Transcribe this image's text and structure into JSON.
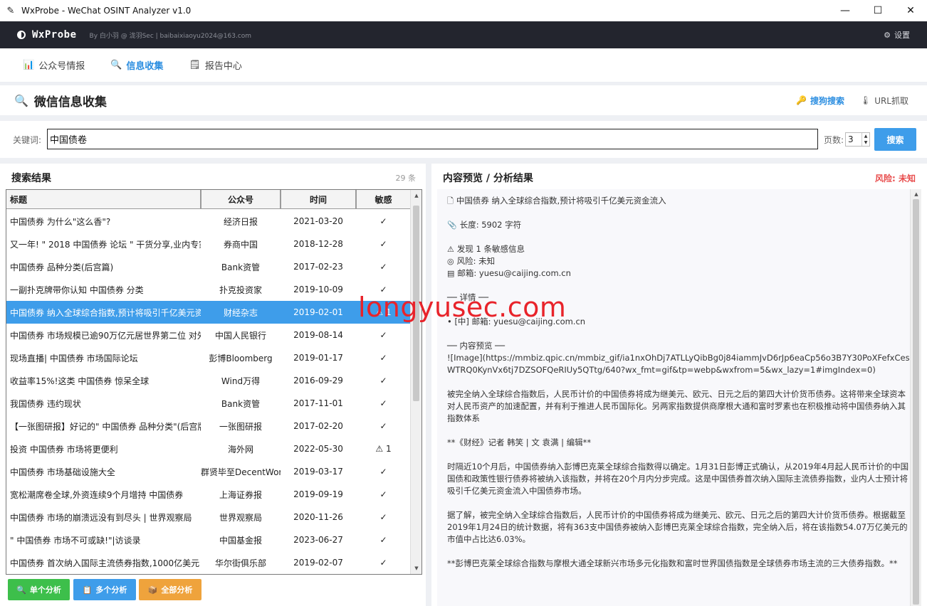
{
  "window": {
    "title": "WxProbe - WeChat OSINT Analyzer v1.0",
    "controls": {
      "minimize": "—",
      "maximize": "☐",
      "close": "✕"
    }
  },
  "appbar": {
    "logo": "WxProbe",
    "meta": "By 白小羽 @ 泷羽Sec  |  baibaixiaoyu2024@163.com",
    "settings_label": "设置"
  },
  "nav": {
    "tabs": [
      {
        "label": "公众号情报",
        "active": false
      },
      {
        "label": "信息收集",
        "active": true
      },
      {
        "label": "报告中心",
        "active": false
      }
    ]
  },
  "section": {
    "title": "微信信息收集",
    "sogou_label": "搜狗搜索",
    "url_label": "URL抓取"
  },
  "search": {
    "keyword_label": "关键词:",
    "keyword_value": "中国债卷",
    "pages_label": "页数:",
    "pages_value": "3",
    "search_button": "搜索"
  },
  "results": {
    "title": "搜索结果",
    "count": "29 条",
    "columns": [
      "标题",
      "公众号",
      "时间",
      "敏感"
    ],
    "rows": [
      {
        "title": "中国债券 为什么\"这么香\"?",
        "account": "经济日报",
        "date": "2021-03-20",
        "sensitive": "✓"
      },
      {
        "title": "又一年! \" 2018 中国债券 论坛 \" 干货分享,业内专家",
        "account": "券商中国",
        "date": "2018-12-28",
        "sensitive": "✓"
      },
      {
        "title": "中国债券 品种分类(后宫篇)",
        "account": "Bank资管",
        "date": "2017-02-23",
        "sensitive": "✓"
      },
      {
        "title": "一副扑克牌带你认知 中国债券 分类",
        "account": "扑克投资家",
        "date": "2019-10-09",
        "sensitive": "✓"
      },
      {
        "title": "中国债券 纳入全球综合指数,预计将吸引千亿美元资",
        "account": "财经杂志",
        "date": "2019-02-01",
        "sensitive": "⚠ 1",
        "selected": true
      },
      {
        "title": "中国债券 市场规模已逾90万亿元居世界第二位 对外",
        "account": "中国人民银行",
        "date": "2019-08-14",
        "sensitive": "✓"
      },
      {
        "title": "现场直播| 中国债券 市场国际论坛",
        "account": "彭博Bloomberg",
        "date": "2019-01-17",
        "sensitive": "✓"
      },
      {
        "title": "收益率15%!这类 中国债券 惊呆全球",
        "account": "Wind万得",
        "date": "2016-09-29",
        "sensitive": "✓"
      },
      {
        "title": "我国债券 违约现状",
        "account": "Bank资管",
        "date": "2017-11-01",
        "sensitive": "✓"
      },
      {
        "title": "【一张图研报】好记的\" 中国债券 品种分类\"(后宫版",
        "account": "一张图研报",
        "date": "2017-02-20",
        "sensitive": "✓"
      },
      {
        "title": "投资 中国债券 市场将更便利",
        "account": "海外网",
        "date": "2022-05-30",
        "sensitive": "⚠ 1"
      },
      {
        "title": "中国债券 市场基础设施大全",
        "account": "群贤毕至DecentWork",
        "date": "2019-03-17",
        "sensitive": "✓"
      },
      {
        "title": "宽松潮席卷全球,外资连续9个月增持 中国债券",
        "account": "上海证券报",
        "date": "2019-09-19",
        "sensitive": "✓"
      },
      {
        "title": "中国债券 市场的崩溃远没有到尽头 | 世界观察局",
        "account": "世界观察局",
        "date": "2020-11-26",
        "sensitive": "✓"
      },
      {
        "title": "\" 中国债券 市场不可或缺!\"|访谈录",
        "account": "中国基金报",
        "date": "2023-06-27",
        "sensitive": "✓"
      },
      {
        "title": "中国债券 首次纳入国际主流债券指数,1000亿美元",
        "account": "华尔街俱乐部",
        "date": "2019-02-07",
        "sensitive": "✓"
      }
    ]
  },
  "buttons": {
    "single": "单个分析",
    "multi": "多个分析",
    "all": "全部分析"
  },
  "preview": {
    "title": "内容预览 / 分析结果",
    "risk": "风险: 未知",
    "heading": "中国债券 纳入全球综合指数,预计将吸引千亿美元资金流入",
    "length": "长度: 5902 字符",
    "found": "发现 1 条敏感信息",
    "risk_line": "风险: 未知",
    "email_line": "邮箱: yuesu@caijing.com.cn",
    "detail_header": "── 详情 ──",
    "detail_item": "• [中] 邮箱: yuesu@caijing.com.cn",
    "content_header": "── 内容预览 ──",
    "image_line": "![Image](https://mmbiz.qpic.cn/mmbiz_gif/ia1nxOhDj7ATLLyQibBg0j84iammJvD6rJp6eaCp56o3B7Y30PoXFefxCesWTRQ0KynVx6tj7DZSOFQeRIUy5QTtg/640?wx_fmt=gif&tp=webp&wxfrom=5&wx_lazy=1#imgIndex=0)",
    "para1": "被完全纳入全球综合指数后，人民币计价的中国债券将成为继美元、欧元、日元之后的第四大计价货币债券。这将带来全球资本对人民币资产的加速配置，并有利于推进人民币国际化。另两家指数提供商摩根大通和富时罗素也在积极推动将中国债券纳入其指数体系",
    "byline": "**《财经》记者 韩笑 | 文 袁满 | 编辑**",
    "para2": "时隔近10个月后，中国债券纳入彭博巴克莱全球综合指数得以确定。1月31日彭博正式确认，从2019年4月起人民币计价的中国国债和政策性银行债券将被纳入该指数，并将在20个月内分步完成。这是中国债券首次纳入国际主流债券指数，业内人士预计将吸引千亿美元资金流入中国债券市场。",
    "para3": "据了解，被完全纳入全球综合指数后，人民币计价的中国债券将成为继美元、欧元、日元之后的第四大计价货币债券。根据截至2019年1月24日的统计数据，将有363支中国债券被纳入彭博巴克莱全球综合指数，完全纳入后，将在该指数54.07万亿美元的市值中占比达6.03%。",
    "para4": "**彭博巴克莱全球综合指数与摩根大通全球新兴市场多元化指数和富时世界国债指数是全球债券市场主流的三大债券指数。**"
  },
  "watermark": "longyusec.com"
}
